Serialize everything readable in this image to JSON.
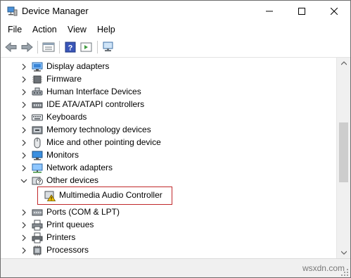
{
  "window": {
    "title": "Device Manager",
    "controls": [
      "minimize",
      "maximize",
      "close"
    ]
  },
  "menu": [
    "File",
    "Action",
    "View",
    "Help"
  ],
  "toolbar": {
    "buttons": [
      "back-icon",
      "forward-icon",
      "properties-icon",
      "help-icon",
      "view-icon",
      "scan-hardware-icon"
    ]
  },
  "tree": {
    "items": [
      {
        "label": "Display adapters",
        "icon": "display-adapter-icon",
        "expander": "collapsed"
      },
      {
        "label": "Firmware",
        "icon": "firmware-icon",
        "expander": "collapsed"
      },
      {
        "label": "Human Interface Devices",
        "icon": "hid-icon",
        "expander": "collapsed"
      },
      {
        "label": "IDE ATA/ATAPI controllers",
        "icon": "ide-controller-icon",
        "expander": "collapsed"
      },
      {
        "label": "Keyboards",
        "icon": "keyboard-icon",
        "expander": "collapsed"
      },
      {
        "label": "Memory technology devices",
        "icon": "memory-device-icon",
        "expander": "collapsed"
      },
      {
        "label": "Mice and other pointing device",
        "icon": "mouse-icon",
        "expander": "collapsed"
      },
      {
        "label": "Monitors",
        "icon": "monitor-icon",
        "expander": "collapsed"
      },
      {
        "label": "Network adapters",
        "icon": "network-adapter-icon",
        "expander": "collapsed"
      },
      {
        "label": "Other devices",
        "icon": "unknown-device-icon",
        "expander": "expanded"
      },
      {
        "label": "Multimedia Audio Controller",
        "icon": "warning-device-icon",
        "expander": "none",
        "child": true,
        "highlighted": true
      },
      {
        "label": "Ports (COM & LPT)",
        "icon": "port-icon",
        "expander": "collapsed"
      },
      {
        "label": "Print queues",
        "icon": "print-queue-icon",
        "expander": "collapsed"
      },
      {
        "label": "Printers",
        "icon": "printer-icon",
        "expander": "collapsed"
      },
      {
        "label": "Processors",
        "icon": "processor-icon",
        "expander": "collapsed"
      }
    ]
  },
  "statusbar": {
    "watermark": "wsxdn.com"
  },
  "colors": {
    "highlight_border": "#c0282b",
    "warning": "#f2c200"
  }
}
